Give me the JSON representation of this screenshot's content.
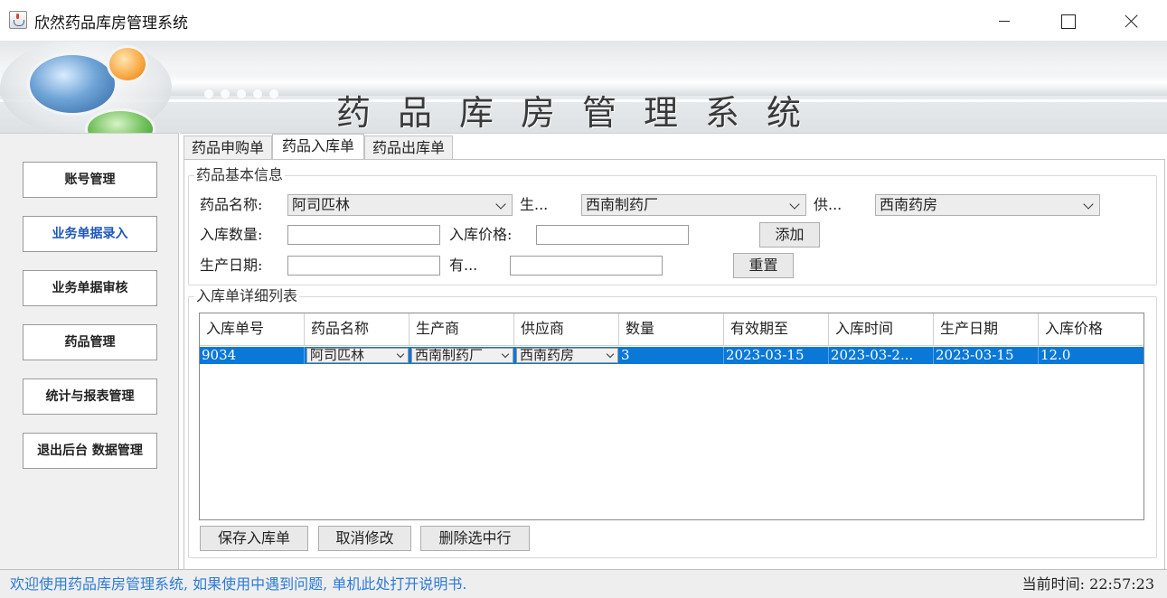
{
  "window": {
    "title": "欣然药品库房管理系统",
    "controls": [
      "minimize-icon",
      "maximize-icon",
      "close-icon"
    ]
  },
  "banner": {
    "title": "药品库房管理系统"
  },
  "sidebar": {
    "items": [
      {
        "label": "账号管理"
      },
      {
        "label": "业务单据录入",
        "active": true
      },
      {
        "label": "业务单据审核"
      },
      {
        "label": "药品管理"
      },
      {
        "label": "统计与报表管理"
      },
      {
        "label": "退出后台 数据管理"
      }
    ]
  },
  "tabs": [
    {
      "label": "药品申购单"
    },
    {
      "label": "药品入库单",
      "active": true
    },
    {
      "label": "药品出库单"
    }
  ],
  "basic_info": {
    "group_title": "药品基本信息",
    "drug_name_label": "药品名称:",
    "drug_name_value": "阿司匹林",
    "manufacturer_label": "生...",
    "manufacturer_value": "西南制药厂",
    "supplier_label": "供...",
    "supplier_value": "西南药房",
    "quantity_label": "入库数量:",
    "quantity_value": "",
    "price_label": "入库价格:",
    "price_value": "",
    "add_button": "添加",
    "production_date_label": "生产日期:",
    "production_date_value": "",
    "expiry_label": "有...",
    "expiry_value": "",
    "reset_button": "重置"
  },
  "detail": {
    "group_title": "入库单详细列表",
    "columns": [
      "入库单号",
      "药品名称",
      "生产商",
      "供应商",
      "数量",
      "有效期至",
      "入库时间",
      "生产日期",
      "入库价格"
    ],
    "rows": [
      {
        "order_no": "9034",
        "drug_name": "阿司匹林",
        "manufacturer": "西南制药厂",
        "supplier": "西南药房",
        "quantity": "3",
        "expiry": "2023-03-15",
        "inbound_time": "2023-03-2...",
        "production_date": "2023-03-15",
        "price": "12.0",
        "selected": true
      }
    ],
    "save_button": "保存入库单",
    "cancel_button": "取消修改",
    "delete_button": "删除选中行"
  },
  "status": {
    "message": "欢迎使用药品库房管理系统, 如果使用中遇到问题, 单机此处打开说明书.",
    "time_label": "当前时间:",
    "time_value": "22:57:23",
    "link_color": "#2b7bd6",
    "selection_color": "#0a78d7"
  }
}
